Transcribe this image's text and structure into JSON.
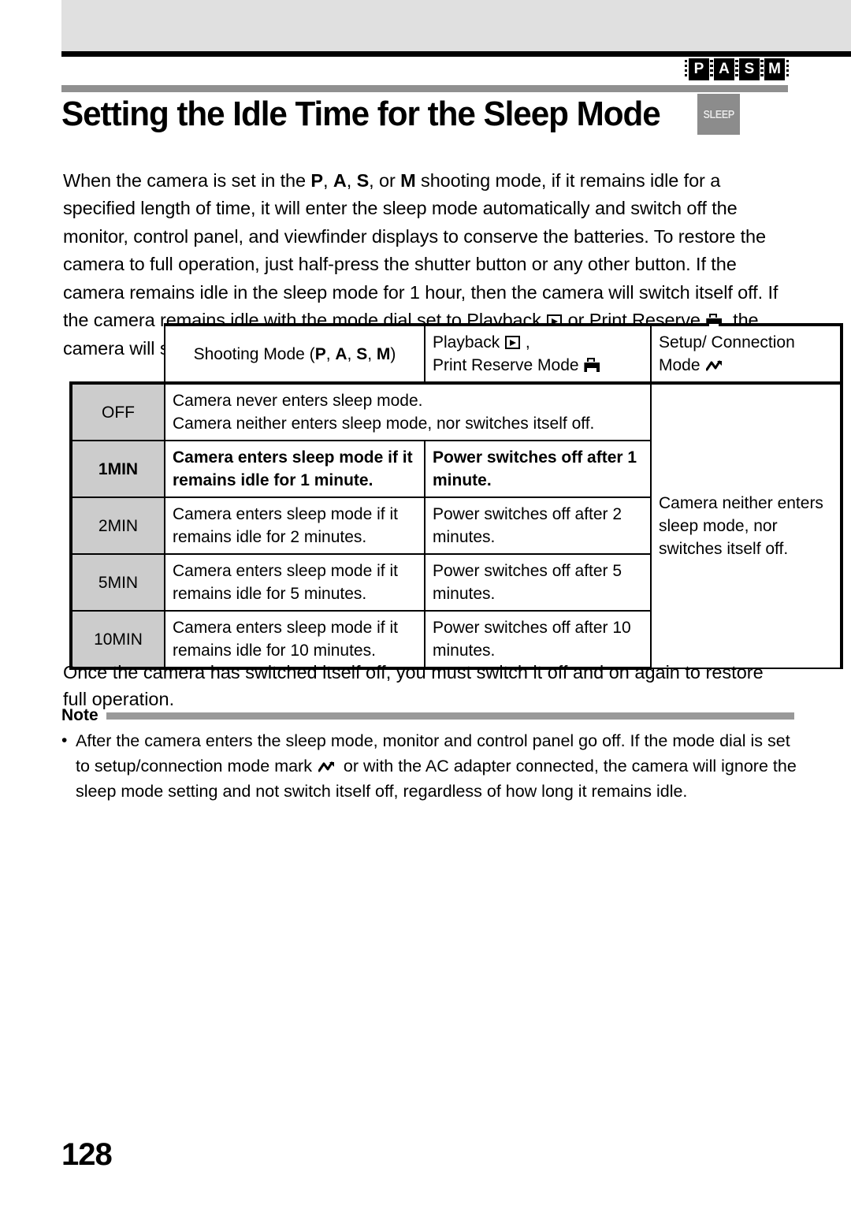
{
  "header": {
    "mode_badges": [
      "P",
      "A",
      "S",
      "M"
    ]
  },
  "title": {
    "text": "Setting the Idle Time for the Sleep Mode",
    "badge_label": "SLEEP"
  },
  "intro": {
    "p1_a": "When the camera is set in the ",
    "p1_P": "P",
    "p1_b": ", ",
    "p1_A": "A",
    "p1_c": ", ",
    "p1_S": "S",
    "p1_d": ", or ",
    "p1_M": "M",
    "p1_e": " shooting mode, if it remains idle for a specified length of time, it will enter the sleep mode automatically and switch off the monitor, control panel, and viewfinder displays to conserve the batteries. To restore the camera to full operation, just half-press the shutter button or any other button. If the camera remains idle in the sleep mode for 1 hour, then the camera will switch itself off. If the camera remains idle with the mode dial set to Playback ",
    "p1_f": " or Print Reserve ",
    "p1_g": ", the camera will switch itself off after a specified length of time has elapsed."
  },
  "table": {
    "headers": {
      "shooting_a": "Shooting Mode (",
      "shooting_P": "P",
      "shooting_sep1": ", ",
      "shooting_A": "A",
      "shooting_sep2": ", ",
      "shooting_S": "S",
      "shooting_sep3": ", ",
      "shooting_M": "M",
      "shooting_b": ")",
      "playback_line1": "Playback ",
      "playback_line1_end": " ,",
      "playback_line2": "Print Reserve Mode ",
      "setup_line1": "Setup/ Connection",
      "setup_line2": "Mode "
    },
    "rows": [
      {
        "label": "OFF",
        "spanned": "Camera never enters sleep mode.\nCamera neither enters sleep mode, nor switches itself off.",
        "bold": false
      },
      {
        "label": "1MIN",
        "shooting": "Camera enters sleep mode if it remains idle for 1 minute.",
        "playback": "Power switches off after 1 minute.",
        "bold": true
      },
      {
        "label": "2MIN",
        "shooting": "Camera enters sleep mode if it remains idle for 2 minutes.",
        "playback": "Power switches off after 2 minutes.",
        "bold": false
      },
      {
        "label": "5MIN",
        "shooting": "Camera enters sleep mode if it remains idle for 5 minutes.",
        "playback": "Power switches off after 5 minutes.",
        "bold": false
      },
      {
        "label": "10MIN",
        "shooting": "Camera enters sleep mode if it remains idle for 10 minutes.",
        "playback": "Power switches off after 10 minutes.",
        "bold": false
      }
    ],
    "setup_cell": "Camera neither enters sleep mode, nor switches itself off."
  },
  "after_table": {
    "text": "Once the camera has switched itself off, you must switch it off and on again to restore full operation."
  },
  "note": {
    "label": "Note",
    "bullet": "•",
    "text_a": "After the camera enters the sleep mode, monitor and control panel go off. If the mode dial is set to setup/connection mode mark ",
    "text_b": " or with the AC adapter connected, the camera will ignore the sleep mode setting and not switch itself off, regardless of how long it remains idle."
  },
  "footer": {
    "page_number": "128"
  },
  "colors": {
    "header_band": "#e0e0e0",
    "title_rule": "#909090",
    "sleep_badge": "#8c8c8c",
    "table_label_bg": "#cccccc",
    "note_bar": "#999999"
  }
}
